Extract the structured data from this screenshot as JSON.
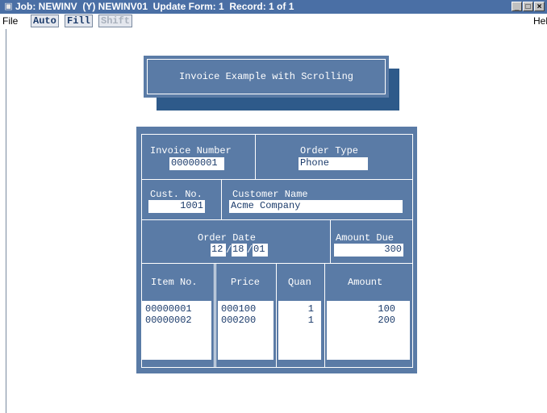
{
  "window": {
    "title": "Job: NEWINV  (Y) NEWINV01  Update Form: 1  Record: 1 of 1",
    "app_icon": "app-icon",
    "controls": [
      "_",
      "□",
      "×"
    ]
  },
  "menubar": {
    "file": "File",
    "auto": "Auto",
    "fill": "Fill",
    "shift": "Shift",
    "help": "Help"
  },
  "banner": {
    "title": "Invoice Example with Scrolling"
  },
  "form": {
    "invoice_number": {
      "label": "Invoice Number",
      "value": "00000001"
    },
    "order_type": {
      "label": "Order Type",
      "value": "Phone"
    },
    "cust_no": {
      "label": "Cust. No.",
      "value": "1001"
    },
    "customer_name": {
      "label": "Customer Name",
      "value": "Acme Company"
    },
    "order_date": {
      "label": "Order Date",
      "month": "12",
      "day": "18",
      "year": "01"
    },
    "amount_due": {
      "label": "Amount Due",
      "value": "300"
    },
    "items": {
      "headers": {
        "item_no": "Item No.",
        "price": "Price",
        "quan": "Quan",
        "amount": "Amount"
      },
      "rows": [
        {
          "item_no": "00000001",
          "price": "000100",
          "quan": "1",
          "amount": "100"
        },
        {
          "item_no": "00000002",
          "price": "000200",
          "quan": "1",
          "amount": "200"
        }
      ]
    }
  },
  "colors": {
    "titlebar": "#4a6fa5",
    "form_bg": "#5a7ba6",
    "banner_shadow": "#2e5a8a",
    "field_text": "#1a3a6a"
  }
}
